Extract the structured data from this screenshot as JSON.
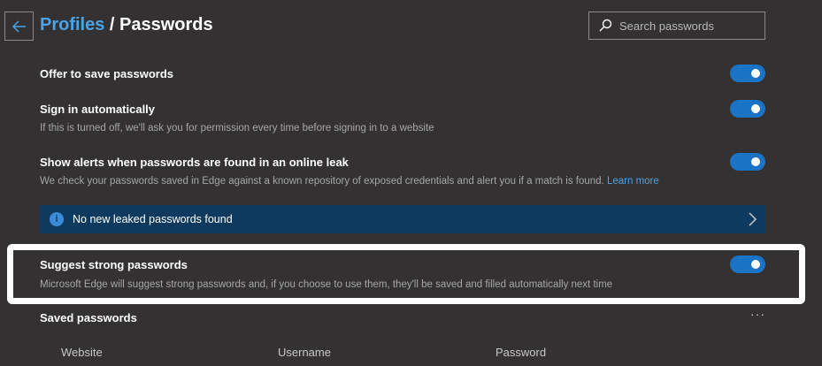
{
  "header": {
    "back_label": "←",
    "breadcrumb_parent": "Profiles",
    "breadcrumb_sep": " / ",
    "page_title": "Passwords"
  },
  "search": {
    "placeholder": "Search passwords"
  },
  "settings": {
    "offer_save": {
      "title": "Offer to save passwords",
      "enabled": true
    },
    "sign_in": {
      "title": "Sign in automatically",
      "desc": "If this is turned off, we'll ask you for permission every time before signing in to a website",
      "enabled": true
    },
    "leak_alerts": {
      "title": "Show alerts when passwords are found in an online leak",
      "desc": "We check your passwords saved in Edge against a known repository of exposed credentials and alert you if a match is found.",
      "link": "Learn more",
      "enabled": true
    },
    "strong_passwords": {
      "title": "Suggest strong passwords",
      "desc": "Microsoft Edge will suggest strong passwords and, if you choose to use them, they'll be saved and filled automatically next time",
      "enabled": true
    }
  },
  "leak_banner": {
    "icon": "info-icon",
    "text": "No new leaked passwords found"
  },
  "saved": {
    "title": "Saved passwords",
    "more": "···",
    "columns": [
      "Website",
      "Username",
      "Password"
    ]
  },
  "colors": {
    "accent": "#1a73c4",
    "link": "#4ba3e8",
    "background": "#333131",
    "banner": "#0f3a5f"
  }
}
